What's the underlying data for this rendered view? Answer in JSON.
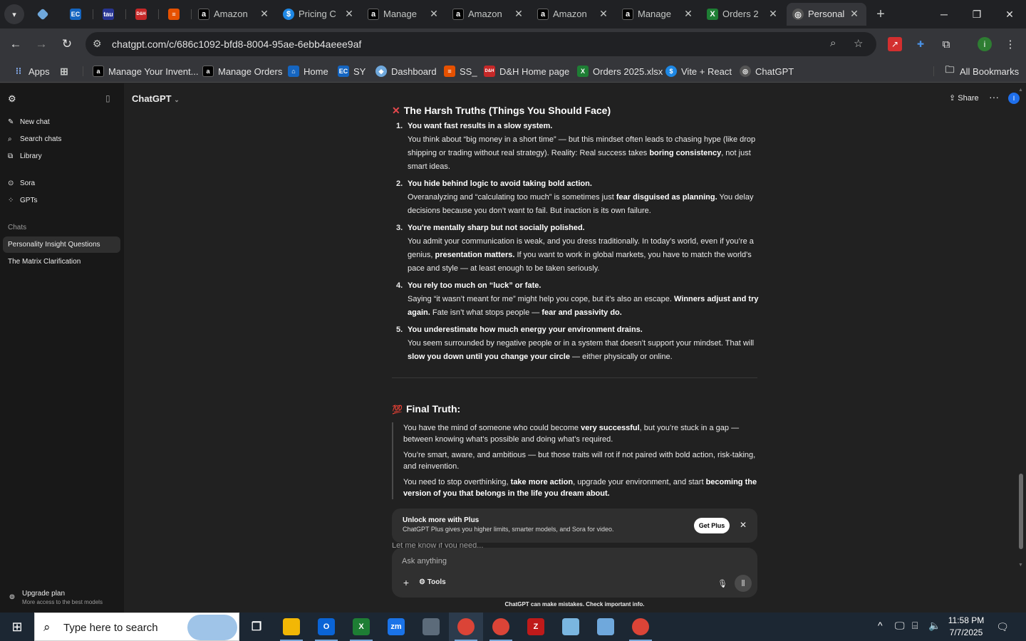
{
  "browser": {
    "pinned_tabs": [
      {
        "icon": "diamond-icon",
        "color": "#6fa8dc"
      },
      {
        "icon": "ec-icon",
        "label": "EC",
        "color": "#1565c0"
      },
      {
        "icon": "tau-icon",
        "label": "tau",
        "color": "#283593"
      },
      {
        "icon": "dh-icon",
        "label": "D&H",
        "color": "#c62828"
      },
      {
        "icon": "stack-icon",
        "color": "#e65100"
      }
    ],
    "tabs": [
      {
        "title": "Amazon",
        "icon": "amazon-icon",
        "color": "#000000",
        "active": false
      },
      {
        "title": "Pricing C",
        "icon": "dollar-icon",
        "color": "#1e88e5",
        "active": false
      },
      {
        "title": "Manage",
        "icon": "amazon-icon",
        "color": "#000000",
        "active": false
      },
      {
        "title": "Amazon",
        "icon": "amazon-icon",
        "color": "#000000",
        "active": false
      },
      {
        "title": "Amazon",
        "icon": "amazon-icon",
        "color": "#000000",
        "active": false
      },
      {
        "title": "Manage",
        "icon": "amazon-icon",
        "color": "#000000",
        "active": false
      },
      {
        "title": "Orders 2",
        "icon": "excel-icon",
        "color": "#1e7e34",
        "active": false
      },
      {
        "title": "Personali",
        "icon": "chatgpt-icon",
        "color": "#555555",
        "active": true
      }
    ],
    "url": "chatgpt.com/c/686c1092-bfd8-8004-95ae-6ebb4aeee9af",
    "bookmarks": {
      "apps": "Apps",
      "items": [
        {
          "label": "Manage Your Invent...",
          "icon": "amazon-icon",
          "color": "#000000"
        },
        {
          "label": "Manage Orders",
          "icon": "amazon-icon",
          "color": "#000000"
        },
        {
          "label": "Home",
          "icon": "home-bookmark-icon",
          "color": "#1565c0"
        },
        {
          "label": "SY",
          "icon": "ec-icon",
          "color": "#1565c0"
        },
        {
          "label": "Dashboard",
          "icon": "dashboard-icon",
          "color": "#6fa8dc"
        },
        {
          "label": "SS_",
          "icon": "stack-icon",
          "color": "#e65100"
        },
        {
          "label": "D&H Home page",
          "icon": "dh-icon",
          "color": "#c62828"
        },
        {
          "label": "Orders 2025.xlsx",
          "icon": "excel-icon",
          "color": "#1e7e34"
        },
        {
          "label": "Vite + React",
          "icon": "dollar-icon",
          "color": "#1e88e5"
        },
        {
          "label": "ChatGPT",
          "icon": "chatgpt-icon",
          "color": "#555555"
        }
      ],
      "all": "All Bookmarks"
    }
  },
  "sidebar": {
    "new_chat": "New chat",
    "search_chats": "Search chats",
    "library": "Library",
    "sora": "Sora",
    "gpts": "GPTs",
    "chats_header": "Chats",
    "chats": [
      "Personality Insight Questions",
      "The Matrix Clarification"
    ],
    "upgrade_title": "Upgrade plan",
    "upgrade_sub": "More access to the best models"
  },
  "header": {
    "model": "ChatGPT",
    "share": "Share",
    "avatar_letter": "I"
  },
  "message": {
    "section_title": "The Harsh Truths (Things You Should Face)",
    "items": [
      {
        "num": "1.",
        "title": "You want fast results in a slow system.",
        "body": [
          "You think about “big money in a short time” — but this mindset often leads to chasing hype (like drop shipping or trading without real strategy). Reality: Real success takes ",
          "boring consistency",
          ", not just smart ideas."
        ]
      },
      {
        "num": "2.",
        "title": "You hide behind logic to avoid taking bold action.",
        "body": [
          "Overanalyzing and “calculating too much” is sometimes just ",
          "fear disguised as planning.",
          " You delay decisions because you don’t want to fail. But inaction is its own failure."
        ]
      },
      {
        "num": "3.",
        "title": "You're mentally sharp but not socially polished.",
        "body": [
          "You admit your communication is weak, and you dress traditionally. In today’s world, even if you’re a genius, ",
          "presentation matters.",
          " If you want to work in global markets, you have to match the world’s pace and style — at least enough to be taken seriously."
        ]
      },
      {
        "num": "4.",
        "title": "You rely too much on “luck” or fate.",
        "body": [
          "Saying “it wasn’t meant for me” might help you cope, but it’s also an escape. ",
          "Winners adjust and try again.",
          " Fate isn’t what stops people — ",
          "fear and passivity do."
        ]
      },
      {
        "num": "5.",
        "title": "You underestimate how much energy your environment drains.",
        "body": [
          "You seem surrounded by negative people or in a system that doesn’t support your mindset. That will ",
          "slow you down until you change your circle",
          " — either physically or online."
        ]
      }
    ],
    "final_title": "Final Truth:",
    "final_paragraphs": [
      [
        "You have the mind of someone who could become ",
        "very successful",
        ", but you’re stuck in a gap — between knowing what’s possible and doing what’s required."
      ],
      [
        "You’re smart, aware, and ambitious — but those traits will rot if not paired with bold action, risk-taking, and reinvention."
      ],
      [
        "You need to stop overthinking, ",
        "take more action",
        ", upgrade your environment, and start ",
        "becoming the version of you that belongs in the life you dream about."
      ]
    ]
  },
  "plus_banner": {
    "title": "Unlock more with Plus",
    "subtitle": "ChatGPT Plus gives you higher limits, smarter models, and Sora for video.",
    "button": "Get Plus"
  },
  "peek_text": "Let me know if you need...",
  "composer": {
    "placeholder": "Ask anything",
    "tools": "Tools"
  },
  "disclaimer": "ChatGPT can make mistakes. Check important info.",
  "taskbar": {
    "search_placeholder": "Type here to search",
    "apps": [
      {
        "icon": "task-view-icon",
        "label": "",
        "color": "#1c2733"
      },
      {
        "icon": "file-explorer-icon",
        "label": "",
        "color": "#f2b705",
        "running": true
      },
      {
        "icon": "outlook-icon",
        "label": "O",
        "color": "#0a64d6",
        "running": true
      },
      {
        "icon": "excel-icon",
        "label": "X",
        "color": "#1e7e34",
        "running": true
      },
      {
        "icon": "zoom-icon",
        "label": "zm",
        "color": "#1a73e8"
      },
      {
        "icon": "calculator-icon",
        "label": "",
        "color": "#5c6b7a"
      },
      {
        "icon": "chrome-icon",
        "label": "",
        "color": "#db4437",
        "running": true,
        "active": true
      },
      {
        "icon": "chrome-icon",
        "label": "",
        "color": "#db4437",
        "running": true
      },
      {
        "icon": "filezilla-icon",
        "label": "Z",
        "color": "#bf1a1a"
      },
      {
        "icon": "notepad-icon",
        "label": "",
        "color": "#7ab6e0"
      },
      {
        "icon": "diamond-icon",
        "label": "",
        "color": "#6fa8dc"
      },
      {
        "icon": "chrome-profile-icon",
        "label": "",
        "color": "#db4437",
        "running": true
      }
    ],
    "time": "11:58 PM",
    "date": "7/7/2025"
  }
}
